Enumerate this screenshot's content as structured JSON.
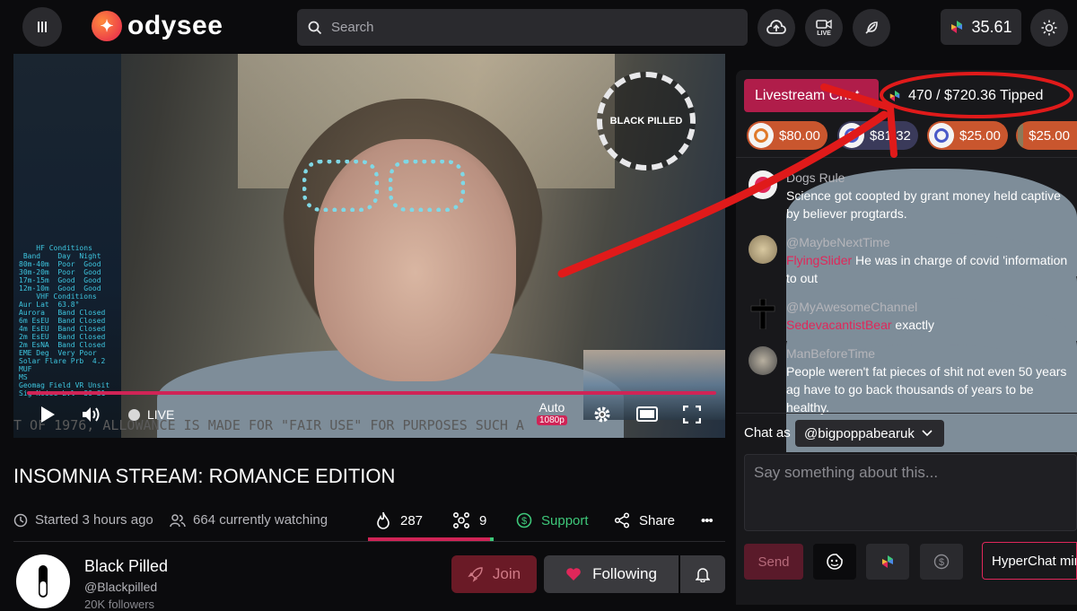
{
  "header": {
    "logo_text": "odysee",
    "search_placeholder": "Search",
    "live_label": "LIVE",
    "credits": "35.61"
  },
  "video": {
    "ticker": "T OF 1976, ALLOWANCE IS MADE FOR \"FAIR USE\" FOR PURPOSES SUCH A",
    "live_label": "LIVE",
    "quality_auto": "Auto",
    "quality_res": "1080p",
    "brand_text": "BLACK PILLED",
    "wx_panel": "    HF Conditions\n Band    Day  Night\n80m-40m  Poor  Good\n30m-20m  Poor  Good\n17m-15m  Good  Good\n12m-10m  Good  Good\n    VHF Conditions\nAur Lat  63.8°\nAurora   Band Closed\n6m EsEU  Band Closed\n4m EsEU  Band Closed\n2m EsEU  Band Closed\n2m EsNA  Band Closed\nEME Deg  Very Poor\nSolar Flare Prb  4.2\nMUF\nMS\nGeomag Field VR Unsit\nSig Noise Lvl  S0-S1"
  },
  "stream": {
    "title": "INSOMNIA STREAM: ROMANCE EDITION",
    "started": "Started 3 hours ago",
    "watching": "664 currently watching",
    "fire_count": "287",
    "slime_count": "9",
    "support_label": "Support",
    "share_label": "Share",
    "more_label": "•••"
  },
  "channel": {
    "name": "Black Pilled",
    "handle": "@Blackpilled",
    "followers": "20K followers",
    "join_label": "Join",
    "following_label": "Following"
  },
  "chat": {
    "tab_label": "Livestream Chat",
    "tipped": "470 / $720.36 Tipped",
    "tips": [
      {
        "amount": "$80.00",
        "ring": "#e07a2a"
      },
      {
        "amount": "$81.32",
        "ring": "#4a5ac8"
      },
      {
        "amount": "$25.00",
        "ring": "#4a5ac8"
      },
      {
        "amount": "$25.00",
        "ring": "#6a4a2a"
      }
    ],
    "messages": [
      {
        "user": "Dogs Rule",
        "mention": "",
        "text": "Science got coopted by grant money held captive by believer progtards."
      },
      {
        "user": "@MaybeNextTime",
        "mention": "FlyingSlider",
        "text": " He was in charge of covid 'information to out"
      },
      {
        "user": "@MyAwesomeChannel",
        "mention": "SedevacantistBear",
        "text": " exactly"
      },
      {
        "user": "ManBeforeTime",
        "mention": "",
        "text": "People weren't fat pieces of shit not even 50 years ag have to go back thousands of years to be healthy."
      }
    ],
    "chat_as_label": "Chat as",
    "chat_as_user": "@bigpoppabearuk",
    "input_placeholder": "Say something about this...",
    "send_label": "Send",
    "hyperchat_label": "HyperChat mir"
  },
  "colors": {
    "accent": "#d02456",
    "annotation_red": "#e01a1a",
    "support_green": "#3ec87a"
  }
}
